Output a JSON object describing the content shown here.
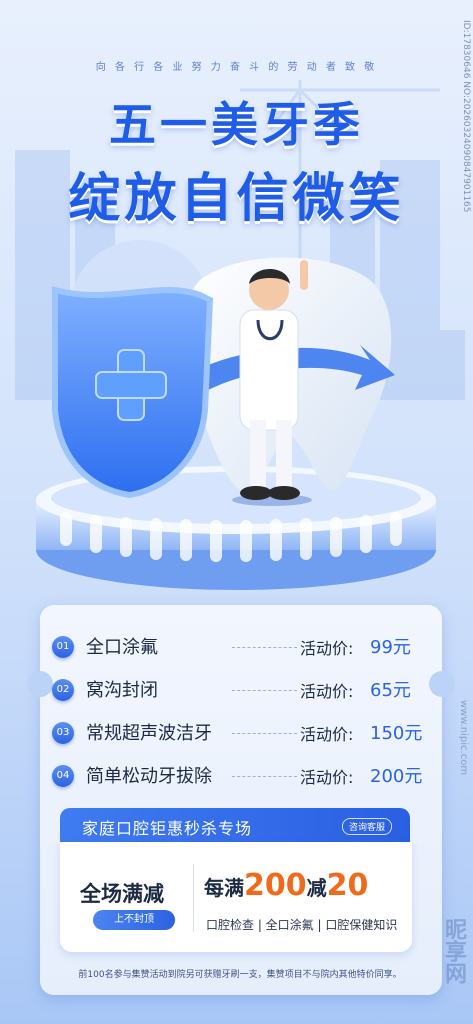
{
  "header": {
    "tagline": "向 各 行 各 业 努 力 奋 斗 的 劳 动 者 致 敬",
    "title_line1": "五一美牙季",
    "title_line2": "绽放自信微笑"
  },
  "watermark": {
    "id_text": "ID:17830646 NO:20260324090847901165",
    "brand": "昵享网",
    "site": "www.nipic.com"
  },
  "services": [
    {
      "num": "01",
      "name": "全口涂氟",
      "price_label": "活动价:",
      "price": "99元"
    },
    {
      "num": "02",
      "name": "窝沟封闭",
      "price_label": "活动价:",
      "price": "65元"
    },
    {
      "num": "03",
      "name": "常规超声波洁牙",
      "price_label": "活动价:",
      "price": "150元"
    },
    {
      "num": "04",
      "name": "简单松动牙拔除",
      "price_label": "活动价:",
      "price": "200元"
    }
  ],
  "promo": {
    "title": "家庭口腔钜惠秒杀专场",
    "consult": "咨询客服",
    "full": "全场满减",
    "no_cap": "上不封顶",
    "deal_prefix": "每满",
    "deal_amount": "200",
    "deal_mid": "减",
    "deal_off": "20",
    "deal_items": "口腔检查 | 全口涂氟 | 口腔保健知识"
  },
  "footer": {
    "note": "前100名参与集赞活动到院另可获赠牙刷一支，集赞项目不与院内其他特价同享。"
  },
  "colors": {
    "accent": "#2a63e6",
    "highlight": "#f06a1c",
    "title": "#1f5de8"
  },
  "icons": [
    "cross-shield-icon",
    "tooth-icon",
    "doctor-figure",
    "arrow-ring-icon"
  ]
}
